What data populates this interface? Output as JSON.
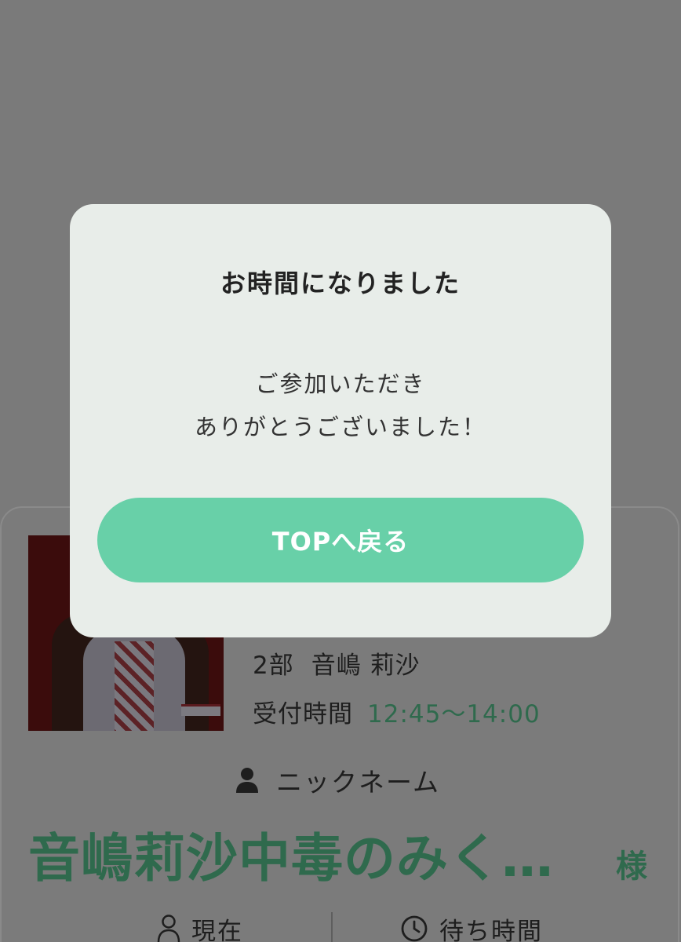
{
  "modal": {
    "title": "お時間になりました",
    "message_line1": "ご参加いただき",
    "message_line2": "ありがとうございました！",
    "button_label": "TOPへ戻る",
    "button_color": "#68d0a8",
    "background_color": "#e8ede9"
  },
  "event": {
    "part": "2部",
    "member_name": "音嶋 莉沙",
    "reception_label": "受付時間",
    "reception_time": "12:45〜14:00"
  },
  "user": {
    "nickname_label": "ニックネーム",
    "nickname_icon": "person-icon",
    "nickname": "音嶋莉沙中毒のみく…",
    "honorific": "様"
  },
  "stats": {
    "current_label": "現在",
    "current_icon": "person-icon",
    "wait_label": "待ち時間",
    "wait_icon": "clock-icon"
  },
  "colors": {
    "accent_green": "#2f6a4d",
    "overlay": "#7a7a7a"
  }
}
